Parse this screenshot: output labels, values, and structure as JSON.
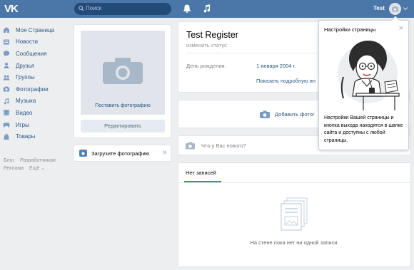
{
  "header": {
    "logo": "VK",
    "search_placeholder": "Поиск",
    "user_name": "Test"
  },
  "nav": {
    "items": [
      {
        "label": "Моя Страница",
        "icon": "home-icon"
      },
      {
        "label": "Новости",
        "icon": "news-icon"
      },
      {
        "label": "Сообщения",
        "icon": "messages-icon"
      },
      {
        "label": "Друзья",
        "icon": "friends-icon"
      },
      {
        "label": "Группы",
        "icon": "groups-icon"
      },
      {
        "label": "Фотографии",
        "icon": "photos-icon"
      },
      {
        "label": "Музыка",
        "icon": "music-icon"
      },
      {
        "label": "Видео",
        "icon": "video-icon"
      },
      {
        "label": "Игры",
        "icon": "games-icon"
      },
      {
        "label": "Товары",
        "icon": "goods-icon"
      }
    ],
    "footer": {
      "blog": "Блог",
      "developers": "Разработчикам",
      "ads": "Реклама",
      "more": "Ещё ⌄"
    }
  },
  "photo": {
    "set_photo": "Поставить фотографию",
    "edit": "Редактировать",
    "upload": "Загрузите фотографию"
  },
  "profile": {
    "name": "Test Register",
    "status": "изменить статус",
    "birthday_label": "День рождения:",
    "birthday_value": "1 января 2004 г.",
    "more_info": "Показать подробную ин"
  },
  "add_photo": {
    "label": "Добавить фотог"
  },
  "post": {
    "placeholder": "Что у Вас нового?"
  },
  "wall": {
    "tab": "Нет записей",
    "empty": "На стене пока нет ни одной записи."
  },
  "tooltip": {
    "title": "Настройки страницы",
    "close": "×",
    "text": "Настройки Вашей страницы и кнопка выхода находятся в шапке сайта и доступны с любой страницы."
  },
  "colors": {
    "header_bg": "#4a76a8",
    "link": "#2a5885",
    "page_bg": "#edeef0"
  }
}
